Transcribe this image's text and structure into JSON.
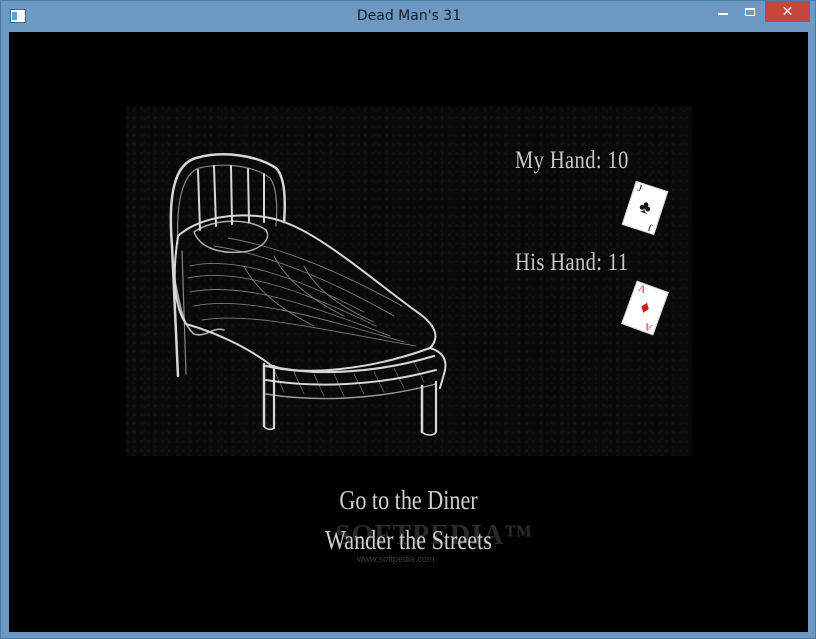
{
  "window": {
    "title": "Dead Man's 31",
    "icons": {
      "app": "app-window-icon",
      "minimize": "minimize-icon",
      "maximize": "maximize-icon",
      "close": "close-icon"
    },
    "close_glyph": "✕",
    "close_color": "#c7453b"
  },
  "scene": {
    "illustration": "bed-sketch"
  },
  "hands": {
    "mine": {
      "label": "My Hand:  10",
      "card": {
        "rank": "J",
        "suit_glyph": "♣",
        "suit_color": "#111111"
      }
    },
    "his": {
      "label": "His Hand:  11",
      "card": {
        "rank": "A",
        "suit_glyph": "♦",
        "suit_color": "#d11a1a"
      }
    }
  },
  "menu": {
    "options": [
      "Go to the Diner",
      "Wander the Streets"
    ]
  },
  "watermark": {
    "text": "SOFTPEDIA™",
    "url": "www.softpedia.com"
  }
}
